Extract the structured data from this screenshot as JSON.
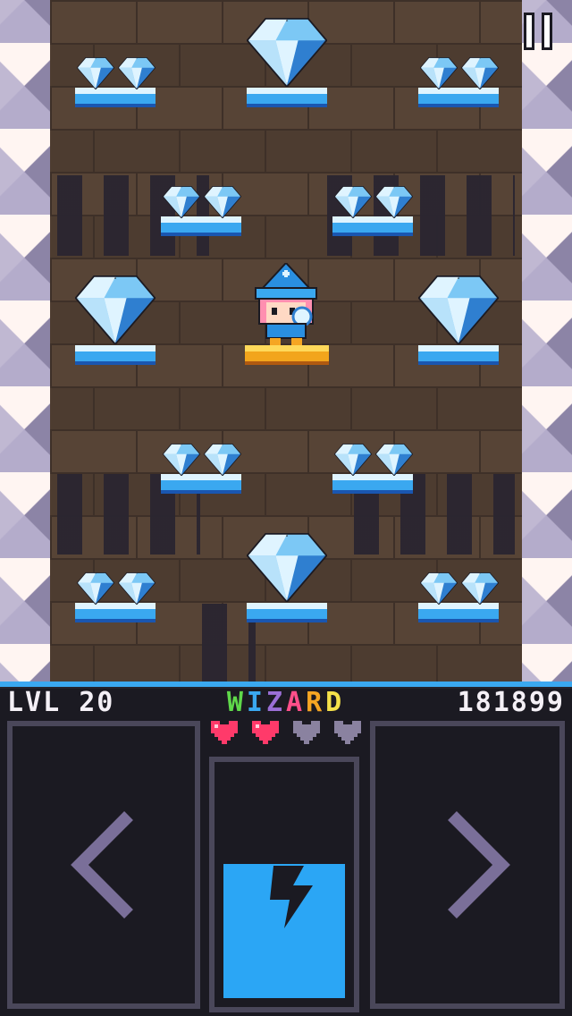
{
  "hud": {
    "level_label": "LVL 20",
    "class_letters": [
      "W",
      "I",
      "Z",
      "A",
      "R",
      "D"
    ],
    "class_colors": [
      "#5fd84a",
      "#3aa8f0",
      "#9b6fd6",
      "#ff4f8a",
      "#f5a623",
      "#f5e14a"
    ],
    "score": "181899",
    "hearts": [
      {
        "state": "full",
        "color": "#ff3a6a"
      },
      {
        "state": "full",
        "color": "#ff3a6a"
      },
      {
        "state": "empty",
        "color": "#8a82a0"
      },
      {
        "state": "empty",
        "color": "#8a82a0"
      }
    ],
    "lives_remaining": 2,
    "lives_total": 4,
    "power_charge": 0.5
  },
  "controls": {
    "left_icon": "chevron-left-icon",
    "right_icon": "chevron-right-icon",
    "power_icon": "lightning-bolt-icon",
    "pause_icon": "pause-icon"
  },
  "colors": {
    "wood": "#574436",
    "ice_platform": "#3aa8f0",
    "gold_platform": "#f2a51c",
    "gem_light": "#dff4ff",
    "gem_mid": "#7cc8f5",
    "gem_dark": "#2f7fd0",
    "accent_blue": "#2ba6f5"
  }
}
